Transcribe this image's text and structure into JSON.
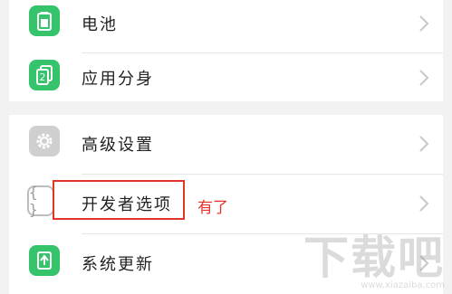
{
  "settings": {
    "items": [
      {
        "label": "电池",
        "icon": "battery-icon"
      },
      {
        "label": "应用分身",
        "icon": "app-clone-icon"
      },
      {
        "label": "高级设置",
        "icon": "gear-icon"
      },
      {
        "label": "开发者选项",
        "icon": "braces-icon"
      },
      {
        "label": "系统更新",
        "icon": "system-update-icon"
      }
    ]
  },
  "annotation": {
    "text": "有了",
    "color": "#e5332a"
  },
  "watermark": {
    "text": "下载吧",
    "url": "www.xiazaiba.com"
  },
  "colors": {
    "accent_green": "#35c46b",
    "highlight_red": "#e5332a"
  }
}
